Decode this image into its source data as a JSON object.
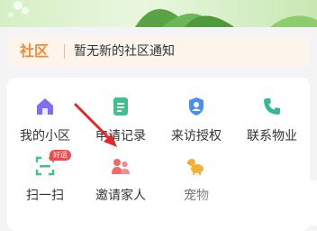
{
  "notice": {
    "tag": "社区",
    "text": "暂无新的社区通知"
  },
  "menu": {
    "items": [
      {
        "label": "我的小区",
        "icon": "home-icon"
      },
      {
        "label": "申请记录",
        "icon": "document-icon"
      },
      {
        "label": "来访授权",
        "icon": "id-badge-icon"
      },
      {
        "label": "联系物业",
        "icon": "phone-icon"
      },
      {
        "label": "扫一扫",
        "icon": "scan-icon",
        "badge": "好运"
      },
      {
        "label": "邀请家人",
        "icon": "family-icon"
      },
      {
        "label": "宠物",
        "icon": "dog-icon"
      }
    ]
  },
  "colors": {
    "accent_orange": "#f08a3a",
    "purple": "#7d6ff0",
    "green": "#3fc08c",
    "blue": "#4a8ff0",
    "teal": "#38b59a",
    "red": "#f06a6a",
    "yellow": "#f2b13a",
    "arrow_red": "#e02a2a"
  }
}
